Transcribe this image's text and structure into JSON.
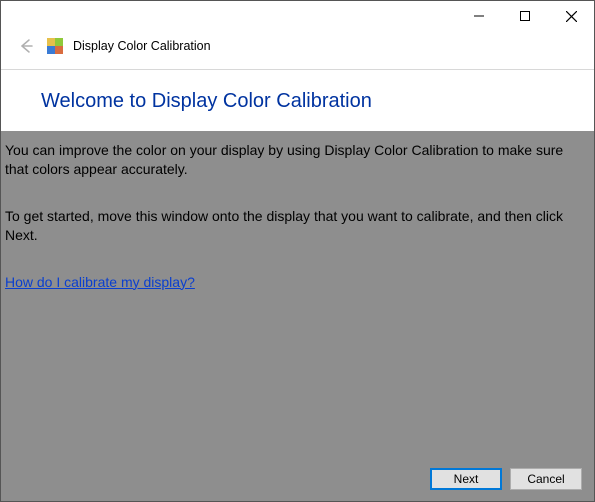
{
  "window": {
    "title": "Display Color Calibration",
    "controls": {
      "minimize": "minimize",
      "maximize": "maximize",
      "close": "close"
    }
  },
  "page": {
    "heading": "Welcome to Display Color Calibration",
    "para1": "You can improve the color on your display by using Display Color Calibration to make sure that colors appear accurately.",
    "para2": "To get started, move this window onto the display that you want to calibrate, and then click Next.",
    "help_link": "How do I calibrate my display?"
  },
  "footer": {
    "next": "Next",
    "cancel": "Cancel"
  }
}
